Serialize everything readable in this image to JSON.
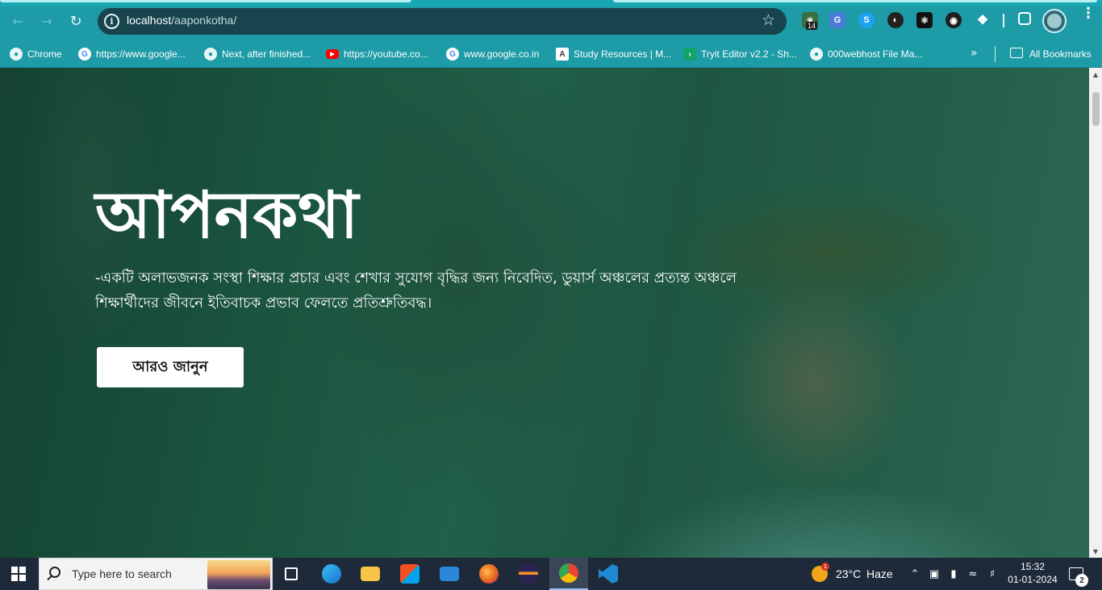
{
  "browser": {
    "url_host": "localhost",
    "url_path": "/aaponkotha/",
    "extension_badge": "14"
  },
  "bookmarks": [
    {
      "label": "Chrome",
      "icon": "globe-icon"
    },
    {
      "label": "https://www.google...",
      "icon": "google-icon"
    },
    {
      "label": "Next, after finished...",
      "icon": "globe-icon"
    },
    {
      "label": "https://youtube.co...",
      "icon": "youtube-icon"
    },
    {
      "label": "www.google.co.in",
      "icon": "google-icon"
    },
    {
      "label": "Study Resources | M...",
      "icon": "study-resources-icon"
    },
    {
      "label": "Tryit Editor v2.2 - Sh...",
      "icon": "tryit-icon"
    },
    {
      "label": "000webhost File Ma...",
      "icon": "globe-icon"
    }
  ],
  "bookmarks_folder": "All Bookmarks",
  "hero": {
    "title": "আপনকথা",
    "description": "-একটি অলাভজনক সংস্থা শিক্ষার প্রচার এবং শেখার সুযোগ বৃদ্ধির জন্য নিবেদিত, ডুয়ার্স অঞ্চলের প্রত্যন্ত অঞ্চলে শিক্ষার্থীদের জীবনে ইতিবাচক প্রভাব ফেলতে প্রতিশ্রুতিবদ্ধ।",
    "button_label": "আরও জানুন"
  },
  "taskbar": {
    "search_placeholder": "Type here to search",
    "weather_temp": "23°C",
    "weather_desc": "Haze",
    "time": "15:32",
    "date": "01-01-2024",
    "notification_count": "2",
    "weather_badge": "1"
  },
  "colors": {
    "chrome_bar": "#1d9ba6",
    "omnibox": "#17444d",
    "taskbar": "#1e2a3a",
    "hero_overlay": "#124832"
  }
}
